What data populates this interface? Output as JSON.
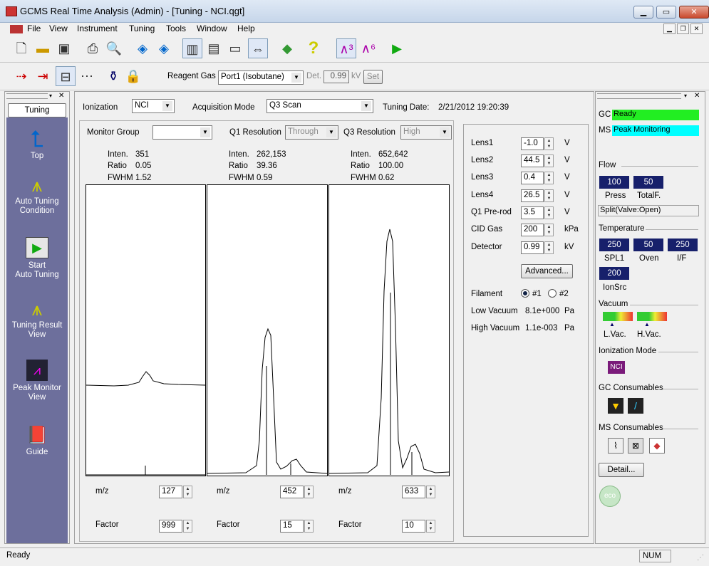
{
  "app": {
    "title": "GCMS Real Time Analysis (Admin) - [Tuning - NCI.qgt]"
  },
  "menu": [
    "File",
    "View",
    "Instrument",
    "Tuning",
    "Tools",
    "Window",
    "Help"
  ],
  "toolbar2": {
    "reagent_label": "Reagent Gas",
    "reagent_value": "Port1 (Isobutane)",
    "det_label": "Det.",
    "det_value": "0.99",
    "det_unit": "kV",
    "set_label": "Set"
  },
  "left": {
    "header": "Tuning",
    "items": [
      "Top",
      "Auto Tuning\nCondition",
      "Start\nAuto Tuning",
      "Tuning Result\nView",
      "Peak Monitor\nView",
      "Guide"
    ]
  },
  "main": {
    "ionization_label": "Ionization",
    "ionization_value": "NCI",
    "acq_label": "Acquisition Mode",
    "acq_value": "Q3 Scan",
    "date_label": "Tuning Date:",
    "date_value": "2/21/2012 19:20:39",
    "monitor_label": "Monitor Group",
    "monitor_value": "",
    "q1_label": "Q1 Resolution",
    "q1_value": "Through",
    "q3_label": "Q3 Resolution",
    "q3_value": "High",
    "inten_label": "Inten.",
    "ratio_label": "Ratio",
    "fwhm_label": "FWHM",
    "mz_label": "m/z",
    "factor_label": "Factor",
    "peaks": [
      {
        "inten": "351",
        "ratio": "0.05",
        "fwhm": "1.52",
        "mz": "127",
        "factor": "999"
      },
      {
        "inten": "262,153",
        "ratio": "39.36",
        "fwhm": "0.59",
        "mz": "452",
        "factor": "15"
      },
      {
        "inten": "652,642",
        "ratio": "100.00",
        "fwhm": "0.62",
        "mz": "633",
        "factor": "10"
      }
    ]
  },
  "lens": {
    "rows": [
      {
        "label": "Lens1",
        "value": "-1.0",
        "unit": "V"
      },
      {
        "label": "Lens2",
        "value": "44.5",
        "unit": "V"
      },
      {
        "label": "Lens3",
        "value": "0.4",
        "unit": "V"
      },
      {
        "label": "Lens4",
        "value": "26.5",
        "unit": "V"
      },
      {
        "label": "Q1 Pre-rod",
        "value": "3.5",
        "unit": "V"
      },
      {
        "label": "CID Gas",
        "value": "200",
        "unit": "kPa"
      },
      {
        "label": "Detector",
        "value": "0.99",
        "unit": "kV"
      }
    ],
    "advanced": "Advanced...",
    "filament_label": "Filament",
    "fil1": "#1",
    "fil2": "#2",
    "lowvac_label": "Low Vacuum",
    "lowvac_value": "8.1e+000",
    "lowvac_unit": "Pa",
    "highvac_label": "High Vacuum",
    "highvac_value": "1.1e-003",
    "highvac_unit": "Pa"
  },
  "right": {
    "gc_label": "GC",
    "gc_status": "Ready",
    "ms_label": "MS",
    "ms_status": "Peak Monitoring",
    "flow_label": "Flow",
    "press_value": "100",
    "press_label": "Press",
    "total_value": "50",
    "total_label": "TotalF.",
    "split": "Split(Valve:Open)",
    "temp_label": "Temperature",
    "spl_value": "250",
    "spl_label": "SPL1",
    "oven_value": "50",
    "oven_label": "Oven",
    "if_value": "250",
    "if_label": "I/F",
    "ion_value": "200",
    "ion_label": "IonSrc",
    "vacuum_label": "Vacuum",
    "lvac_label": "L.Vac.",
    "hvac_label": "H.Vac.",
    "ionmode_label": "Ionization Mode",
    "ionmode_value": "NCI",
    "gccons_label": "GC Consumables",
    "mscons_label": "MS Consumables",
    "detail": "Detail...",
    "eco": "eco"
  },
  "status": {
    "left": "Ready",
    "num": "NUM"
  },
  "colors": {
    "gc_status": "#22ee22",
    "ms_status": "#00ffff",
    "navy": "#17206b",
    "leftbar": "#6d6f9c"
  }
}
